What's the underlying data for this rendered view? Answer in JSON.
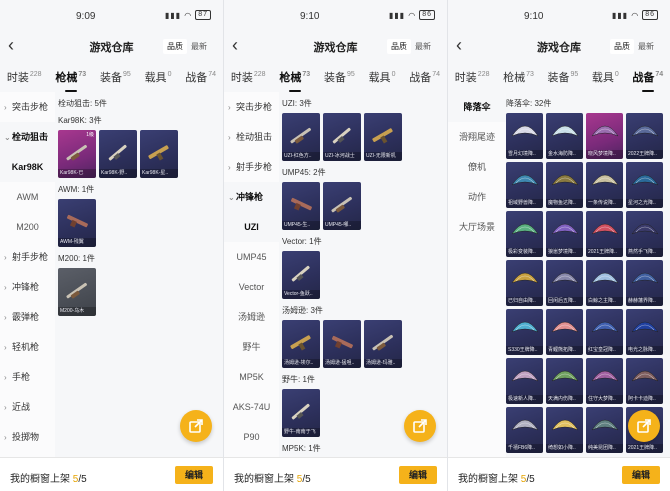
{
  "panels": [
    {
      "time": "9:09",
      "battery": "87",
      "title": "游戏仓库",
      "sort": [
        "品质",
        "最新"
      ],
      "tabs": [
        {
          "label": "时装",
          "count": "228"
        },
        {
          "label": "枪械",
          "count": "73",
          "active": true
        },
        {
          "label": "装备",
          "count": "95"
        },
        {
          "label": "载具",
          "count": "0"
        },
        {
          "label": "战备",
          "count": "74"
        }
      ],
      "side": [
        {
          "label": "突击步枪",
          "caret": "›"
        },
        {
          "label": "栓动狙击",
          "caret": "⌄",
          "sel": true
        },
        {
          "label": "Kar98K",
          "child": true,
          "sel": true
        },
        {
          "label": "AWM",
          "child": true
        },
        {
          "label": "M200",
          "child": true
        },
        {
          "label": "射手步枪",
          "caret": "›"
        },
        {
          "label": "冲锋枪",
          "caret": "›"
        },
        {
          "label": "霰弹枪",
          "caret": "›"
        },
        {
          "label": "轻机枪",
          "caret": "›"
        },
        {
          "label": "手枪",
          "caret": "›"
        },
        {
          "label": "近战",
          "caret": "›"
        },
        {
          "label": "投掷物",
          "caret": "›"
        }
      ],
      "header": "栓动狙击: 5件",
      "sections": [
        {
          "label": "Kar98K: 3件",
          "cards": [
            {
              "cap": "Kar98K-已",
              "style": "pink",
              "badge": "1级"
            },
            {
              "cap": "Kar98K-野..",
              "style": ""
            },
            {
              "cap": "Kar98K-星..",
              "style": ""
            }
          ]
        },
        {
          "label": "AWM: 1件",
          "cards": [
            {
              "cap": "AWM-残翼",
              "style": ""
            }
          ]
        },
        {
          "label": "M200: 1件",
          "cards": [
            {
              "cap": "M200-乌木",
              "style": "grey"
            }
          ]
        }
      ],
      "bottom": {
        "prefix": "我的橱窗上架 ",
        "count": "5",
        "total": "/5",
        "edit": "编辑"
      }
    },
    {
      "time": "9:10",
      "battery": "86",
      "title": "游戏仓库",
      "sort": [
        "品质",
        "最新"
      ],
      "tabs": [
        {
          "label": "时装",
          "count": "228"
        },
        {
          "label": "枪械",
          "count": "73",
          "active": true
        },
        {
          "label": "装备",
          "count": "95"
        },
        {
          "label": "载具",
          "count": "0"
        },
        {
          "label": "战备",
          "count": "74"
        }
      ],
      "side": [
        {
          "label": "突击步枪",
          "caret": "›"
        },
        {
          "label": "栓动狙击",
          "caret": "›"
        },
        {
          "label": "射手步枪",
          "caret": "›"
        },
        {
          "label": "冲锋枪",
          "caret": "⌄",
          "sel": true
        },
        {
          "label": "UZI",
          "child": true,
          "sel": true
        },
        {
          "label": "UMP45",
          "child": true
        },
        {
          "label": "Vector",
          "child": true
        },
        {
          "label": "汤姆逊",
          "child": true
        },
        {
          "label": "野牛",
          "child": true
        },
        {
          "label": "MP5K",
          "child": true
        },
        {
          "label": "AKS-74U",
          "child": true
        },
        {
          "label": "P90",
          "child": true
        }
      ],
      "header": "UZI: 3件",
      "sections": [
        {
          "label": "",
          "cards": [
            {
              "cap": "UZI-红色方..",
              "style": ""
            },
            {
              "cap": "UZI-冰河战士",
              "style": ""
            },
            {
              "cap": "UZI-无限新机",
              "style": ""
            }
          ]
        },
        {
          "label": "UMP45: 2件",
          "cards": [
            {
              "cap": "UMP45-生..",
              "style": ""
            },
            {
              "cap": "UMP45-哪..",
              "style": ""
            }
          ]
        },
        {
          "label": "Vector: 1件",
          "cards": [
            {
              "cap": "Vector-鱼跃..",
              "style": ""
            }
          ]
        },
        {
          "label": "汤姆逊: 3件",
          "cards": [
            {
              "cap": "汤姆逊-埃尔..",
              "style": ""
            },
            {
              "cap": "汤姆逊-猛咀..",
              "style": ""
            },
            {
              "cap": "汤姆逊-玛雅..",
              "style": ""
            }
          ]
        },
        {
          "label": "野牛: 1件",
          "cards": [
            {
              "cap": "野牛-南南于飞",
              "style": ""
            }
          ]
        },
        {
          "label": "MP5K: 1件",
          "cards": []
        }
      ],
      "bottom": {
        "prefix": "我的橱窗上架 ",
        "count": "5",
        "total": "/5",
        "edit": "编辑"
      }
    },
    {
      "time": "9:10",
      "battery": "86",
      "title": "游戏仓库",
      "sort": [
        "品质",
        "最新"
      ],
      "tabs": [
        {
          "label": "时装",
          "count": "228"
        },
        {
          "label": "枪械",
          "count": "73"
        },
        {
          "label": "装备",
          "count": "95"
        },
        {
          "label": "载具",
          "count": "0"
        },
        {
          "label": "战备",
          "count": "74",
          "active": true
        }
      ],
      "side": [
        {
          "label": "降落伞",
          "child": true,
          "sel": true
        },
        {
          "label": "滑翔尾迹",
          "child": true
        },
        {
          "label": "僚机",
          "child": true
        },
        {
          "label": "动作",
          "child": true
        },
        {
          "label": "大厅场景",
          "child": true
        }
      ],
      "header": "降落伞: 32件",
      "paraCaps": [
        "雪月幻境降..",
        "金水海防降..",
        "晓风梦境降..",
        "2022王牌降..",
        "祖域野兽降..",
        "魔物鱼达降..",
        "一条传说降..",
        "星河之光降..",
        "极彩变装降..",
        "狼崽梦境降..",
        "2021王牌降..",
        "燕然手飞降..",
        "已归自由降..",
        "回闲后五降..",
        "白鲸之主降..",
        "赫赫藩界降..",
        "S330王牌降..",
        "青鲤熊拓降..",
        "红宝皇冠降..",
        "电光之脉降..",
        "极速新人降..",
        "天满内伤降..",
        "住守大梦降..",
        "阿卡卡迪降..",
        "千禧FB6降..",
        "绮想如小降..",
        "纯美昆团降..",
        "2021王牌降.."
      ],
      "bottom": {
        "prefix": "我的橱窗上架 ",
        "count": "5",
        "total": "/5",
        "edit": "编辑"
      }
    }
  ],
  "colors": {
    "accent": "#f5b21a",
    "card": "#2c2f5a",
    "pink": "#a8388f"
  },
  "icons": {
    "fab": "share-out-icon",
    "back": "chevron-left-icon"
  }
}
